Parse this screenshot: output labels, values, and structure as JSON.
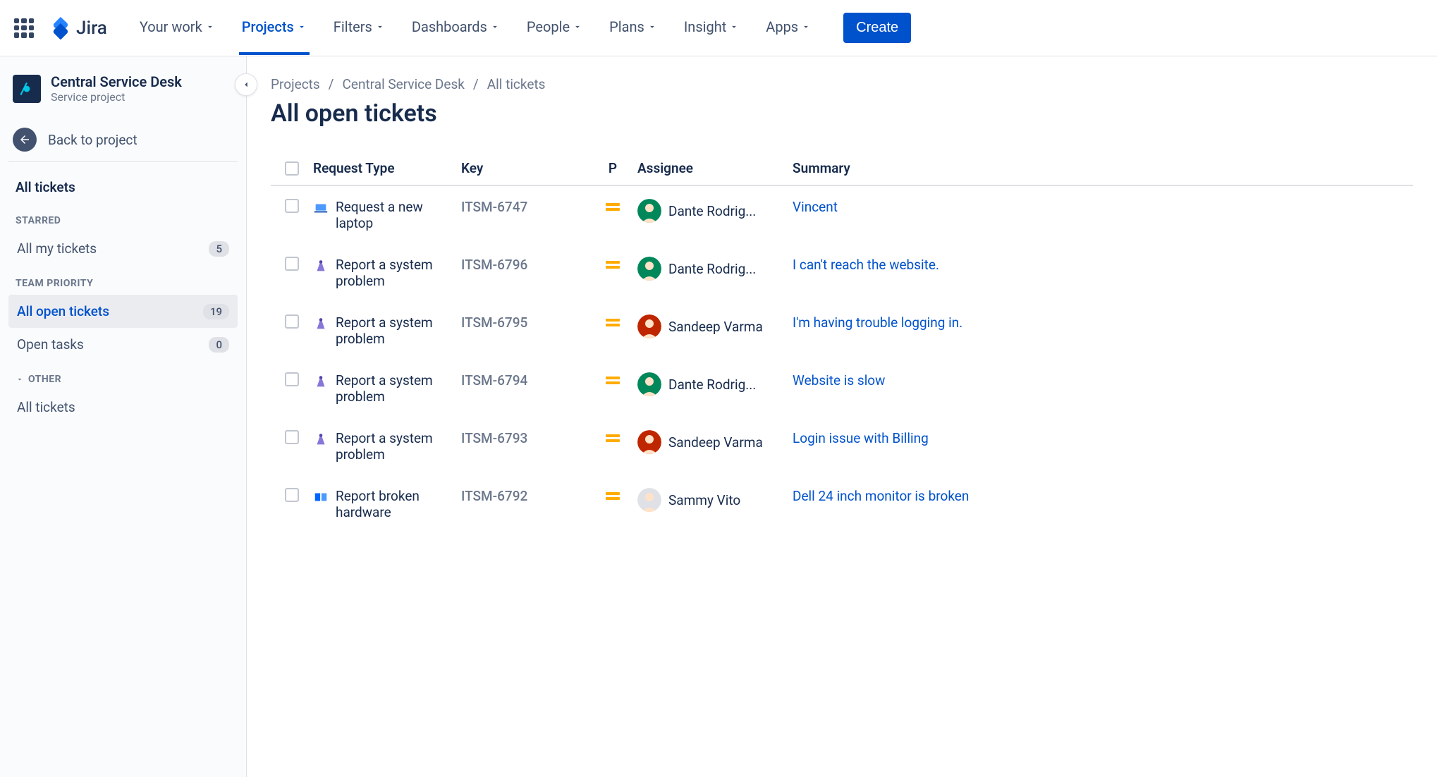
{
  "brand": "Jira",
  "nav": {
    "items": [
      {
        "label": "Your work"
      },
      {
        "label": "Projects"
      },
      {
        "label": "Filters"
      },
      {
        "label": "Dashboards"
      },
      {
        "label": "People"
      },
      {
        "label": "Plans"
      },
      {
        "label": "Insight"
      },
      {
        "label": "Apps"
      }
    ],
    "create": "Create"
  },
  "sidebar": {
    "project_name": "Central Service Desk",
    "project_type": "Service project",
    "back": "Back to project",
    "heading": "All tickets",
    "sections": {
      "starred": "STARRED",
      "team_priority": "TEAM PRIORITY",
      "other": "OTHER"
    },
    "items": {
      "all_my_tickets": {
        "label": "All my tickets",
        "count": "5"
      },
      "all_open_tickets": {
        "label": "All open tickets",
        "count": "19"
      },
      "open_tasks": {
        "label": "Open tasks",
        "count": "0"
      },
      "all_tickets": {
        "label": "All tickets"
      }
    }
  },
  "breadcrumb": [
    "Projects",
    "Central Service Desk",
    "All tickets"
  ],
  "page_title": "All open tickets",
  "columns": {
    "type": "Request Type",
    "key": "Key",
    "p": "P",
    "assignee": "Assignee",
    "summary": "Summary"
  },
  "tickets": [
    {
      "type": "Request a new laptop",
      "type_icon": "laptop",
      "key": "ITSM-6747",
      "assignee": "Dante Rodrig...",
      "avatar_bg": "#00875A",
      "summary": "Vincent"
    },
    {
      "type": "Report a system problem",
      "type_icon": "system",
      "key": "ITSM-6796",
      "assignee": "Dante Rodrig...",
      "avatar_bg": "#00875A",
      "summary": "I can't reach the website."
    },
    {
      "type": "Report a system problem",
      "type_icon": "system",
      "key": "ITSM-6795",
      "assignee": "Sandeep Varma",
      "avatar_bg": "#BF2600",
      "summary": "I'm having trouble logging in."
    },
    {
      "type": "Report a system problem",
      "type_icon": "system",
      "key": "ITSM-6794",
      "assignee": "Dante Rodrig...",
      "avatar_bg": "#00875A",
      "summary": "Website is slow"
    },
    {
      "type": "Report a system problem",
      "type_icon": "system",
      "key": "ITSM-6793",
      "assignee": "Sandeep Varma",
      "avatar_bg": "#BF2600",
      "summary": "Login issue with Billing"
    },
    {
      "type": "Report broken hardware",
      "type_icon": "hardware",
      "key": "ITSM-6792",
      "assignee": "Sammy Vito",
      "avatar_bg": "#DFE1E6",
      "summary": "Dell 24 inch monitor is broken"
    }
  ]
}
